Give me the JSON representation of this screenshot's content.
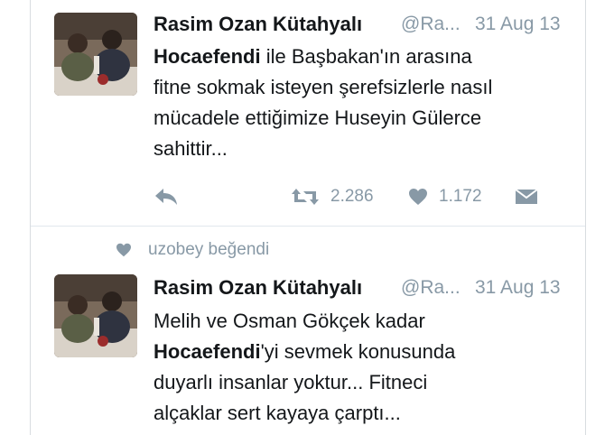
{
  "tweets": [
    {
      "author_name": "Rasim Ozan Kütahyalı",
      "handle": "@Ra...",
      "date": "31 Aug 13",
      "lines": [
        {
          "bold": "Hocaefendi",
          "rest": " ile Başbakan'ın arasına"
        },
        {
          "bold": "",
          "rest": "fitne sokmak isteyen şerefsizlerle nasıl"
        },
        {
          "bold": "",
          "rest": "mücadele ettiğimize Huseyin Gülerce"
        },
        {
          "bold": "",
          "rest": "sahittir..."
        }
      ],
      "retweets": "2.286",
      "likes": "1.172"
    },
    {
      "author_name": "Rasim Ozan Kütahyalı",
      "handle": "@Ra...",
      "date": "31 Aug 13",
      "lines": [
        {
          "bold": "",
          "rest": "Melih ve Osman Gökçek kadar"
        },
        {
          "bold": "Hocaefendi",
          "rest": "'yi sevmek konusunda"
        },
        {
          "bold": "",
          "rest": "duyarlı insanlar yoktur... Fitneci"
        },
        {
          "bold": "",
          "rest": "alçaklar sert kayaya çarptı..."
        }
      ]
    }
  ],
  "liked_by": "uzobey beğendi",
  "icons": {
    "reply": "reply-icon",
    "retweet": "retweet-icon",
    "like": "heart-icon",
    "message": "direct-message-icon"
  },
  "colors": {
    "text": "#14171a",
    "muted": "#8899a6",
    "divider": "#e1e8ed"
  }
}
